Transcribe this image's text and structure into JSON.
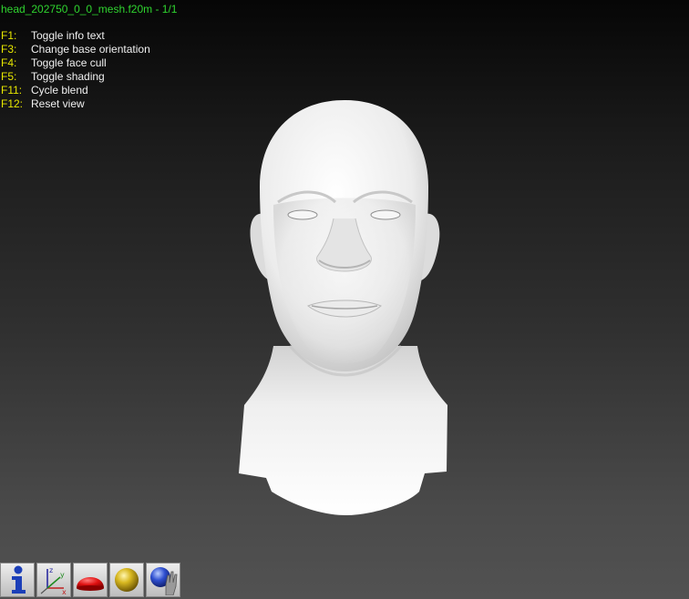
{
  "window": {
    "title": "head_202750_0_0_mesh.f20m - 1/1"
  },
  "help": [
    {
      "key": "F1:",
      "label": "Toggle info text"
    },
    {
      "key": "F3:",
      "label": "Change base orientation"
    },
    {
      "key": "F4:",
      "label": "Toggle face cull"
    },
    {
      "key": "F5:",
      "label": "Toggle shading"
    },
    {
      "key": "F11:",
      "label": "Cycle blend"
    },
    {
      "key": "F12:",
      "label": "Reset view"
    }
  ],
  "toolbar": {
    "buttons": [
      {
        "name": "info",
        "icon": "info-icon"
      },
      {
        "name": "axes",
        "icon": "axes-icon",
        "axis_labels": [
          "z",
          "y",
          "x"
        ]
      },
      {
        "name": "shape",
        "icon": "red-dome-icon"
      },
      {
        "name": "material",
        "icon": "gold-sphere-icon"
      },
      {
        "name": "light",
        "icon": "blue-sphere-hand-icon"
      }
    ]
  },
  "colors": {
    "title": "#2fd42f",
    "help_key": "#e6e600",
    "help_label": "#f0f0f0"
  }
}
